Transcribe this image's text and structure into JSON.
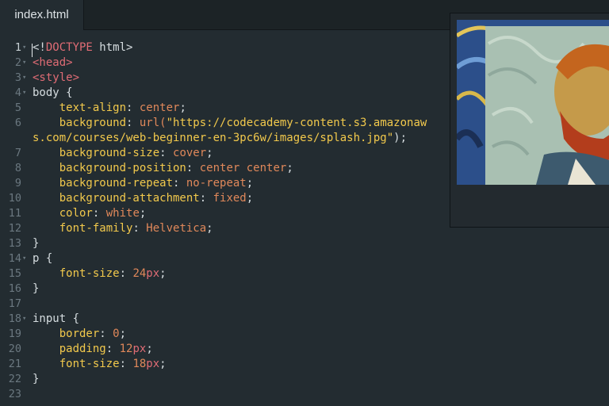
{
  "tabs": [
    {
      "label": "index.html"
    }
  ],
  "editor": {
    "lines": [
      {
        "n": "1",
        "fold": true,
        "tokens": [
          {
            "t": "<!",
            "c": "c-plain"
          },
          {
            "t": "DOCTYPE",
            "c": "c-tag"
          },
          {
            "t": " html>",
            "c": "c-plain"
          }
        ]
      },
      {
        "n": "2",
        "fold": true,
        "tokens": [
          {
            "t": "<head>",
            "c": "c-tag"
          }
        ]
      },
      {
        "n": "3",
        "fold": true,
        "tokens": [
          {
            "t": "<style>",
            "c": "c-tag"
          }
        ]
      },
      {
        "n": "4",
        "fold": true,
        "tokens": [
          {
            "t": "body {",
            "c": "c-plain"
          }
        ]
      },
      {
        "n": "5",
        "fold": false,
        "tokens": [
          {
            "t": "    ",
            "c": "c-plain"
          },
          {
            "t": "text-align",
            "c": "c-prop"
          },
          {
            "t": ": ",
            "c": "c-plain"
          },
          {
            "t": "center",
            "c": "c-val"
          },
          {
            "t": ";",
            "c": "c-plain"
          }
        ]
      },
      {
        "n": "6",
        "fold": false,
        "tokens": [
          {
            "t": "    ",
            "c": "c-plain"
          },
          {
            "t": "background",
            "c": "c-prop"
          },
          {
            "t": ": ",
            "c": "c-plain"
          },
          {
            "t": "url(",
            "c": "c-fn"
          },
          {
            "t": "\"https://codecademy-content.s3.amazonaw",
            "c": "c-str"
          }
        ]
      },
      {
        "n": "",
        "fold": false,
        "tokens": [
          {
            "t": "s.com/courses/web-beginner-en-3pc6w/images/splash.jpg\"",
            "c": "c-str"
          },
          {
            "t": ");",
            "c": "c-plain"
          }
        ]
      },
      {
        "n": "7",
        "fold": false,
        "tokens": [
          {
            "t": "    ",
            "c": "c-plain"
          },
          {
            "t": "background-size",
            "c": "c-prop"
          },
          {
            "t": ": ",
            "c": "c-plain"
          },
          {
            "t": "cover",
            "c": "c-val"
          },
          {
            "t": ";",
            "c": "c-plain"
          }
        ]
      },
      {
        "n": "8",
        "fold": false,
        "tokens": [
          {
            "t": "    ",
            "c": "c-plain"
          },
          {
            "t": "background-position",
            "c": "c-prop"
          },
          {
            "t": ": ",
            "c": "c-plain"
          },
          {
            "t": "center center",
            "c": "c-val"
          },
          {
            "t": ";",
            "c": "c-plain"
          }
        ]
      },
      {
        "n": "9",
        "fold": false,
        "tokens": [
          {
            "t": "    ",
            "c": "c-plain"
          },
          {
            "t": "background-repeat",
            "c": "c-prop"
          },
          {
            "t": ": ",
            "c": "c-plain"
          },
          {
            "t": "no-repeat",
            "c": "c-val"
          },
          {
            "t": ";",
            "c": "c-plain"
          }
        ]
      },
      {
        "n": "10",
        "fold": false,
        "tokens": [
          {
            "t": "    ",
            "c": "c-plain"
          },
          {
            "t": "background-attachment",
            "c": "c-prop"
          },
          {
            "t": ": ",
            "c": "c-plain"
          },
          {
            "t": "fixed",
            "c": "c-val"
          },
          {
            "t": ";",
            "c": "c-plain"
          }
        ]
      },
      {
        "n": "11",
        "fold": false,
        "tokens": [
          {
            "t": "    ",
            "c": "c-plain"
          },
          {
            "t": "color",
            "c": "c-prop"
          },
          {
            "t": ": ",
            "c": "c-plain"
          },
          {
            "t": "white",
            "c": "c-val"
          },
          {
            "t": ";",
            "c": "c-plain"
          }
        ]
      },
      {
        "n": "12",
        "fold": false,
        "tokens": [
          {
            "t": "    ",
            "c": "c-plain"
          },
          {
            "t": "font-family",
            "c": "c-prop"
          },
          {
            "t": ": ",
            "c": "c-plain"
          },
          {
            "t": "Helvetica",
            "c": "c-val"
          },
          {
            "t": ";",
            "c": "c-plain"
          }
        ]
      },
      {
        "n": "13",
        "fold": false,
        "tokens": [
          {
            "t": "}",
            "c": "c-plain"
          }
        ]
      },
      {
        "n": "14",
        "fold": true,
        "tokens": [
          {
            "t": "p {",
            "c": "c-plain"
          }
        ]
      },
      {
        "n": "15",
        "fold": false,
        "tokens": [
          {
            "t": "    ",
            "c": "c-plain"
          },
          {
            "t": "font-size",
            "c": "c-prop"
          },
          {
            "t": ": ",
            "c": "c-plain"
          },
          {
            "t": "24",
            "c": "c-num"
          },
          {
            "t": "px",
            "c": "c-unit"
          },
          {
            "t": ";",
            "c": "c-plain"
          }
        ]
      },
      {
        "n": "16",
        "fold": false,
        "tokens": [
          {
            "t": "}",
            "c": "c-plain"
          }
        ]
      },
      {
        "n": "17",
        "fold": false,
        "tokens": []
      },
      {
        "n": "18",
        "fold": true,
        "tokens": [
          {
            "t": "input {",
            "c": "c-plain"
          }
        ]
      },
      {
        "n": "19",
        "fold": false,
        "tokens": [
          {
            "t": "    ",
            "c": "c-plain"
          },
          {
            "t": "border",
            "c": "c-prop"
          },
          {
            "t": ": ",
            "c": "c-plain"
          },
          {
            "t": "0",
            "c": "c-num"
          },
          {
            "t": ";",
            "c": "c-plain"
          }
        ]
      },
      {
        "n": "20",
        "fold": false,
        "tokens": [
          {
            "t": "    ",
            "c": "c-plain"
          },
          {
            "t": "padding",
            "c": "c-prop"
          },
          {
            "t": ": ",
            "c": "c-plain"
          },
          {
            "t": "12",
            "c": "c-num"
          },
          {
            "t": "px",
            "c": "c-unit"
          },
          {
            "t": ";",
            "c": "c-plain"
          }
        ]
      },
      {
        "n": "21",
        "fold": false,
        "tokens": [
          {
            "t": "    ",
            "c": "c-plain"
          },
          {
            "t": "font-size",
            "c": "c-prop"
          },
          {
            "t": ": ",
            "c": "c-plain"
          },
          {
            "t": "18",
            "c": "c-num"
          },
          {
            "t": "px",
            "c": "c-unit"
          },
          {
            "t": ";",
            "c": "c-plain"
          }
        ]
      },
      {
        "n": "22",
        "fold": false,
        "tokens": [
          {
            "t": "}",
            "c": "c-plain"
          }
        ]
      },
      {
        "n": "23",
        "fold": false,
        "tokens": []
      }
    ]
  },
  "colors": {
    "editor_bg": "#232c31",
    "tag": "#e06c75",
    "property": "#f2c94c",
    "value": "#e0885a"
  },
  "icons": {
    "fold": "chevron-down-icon"
  }
}
